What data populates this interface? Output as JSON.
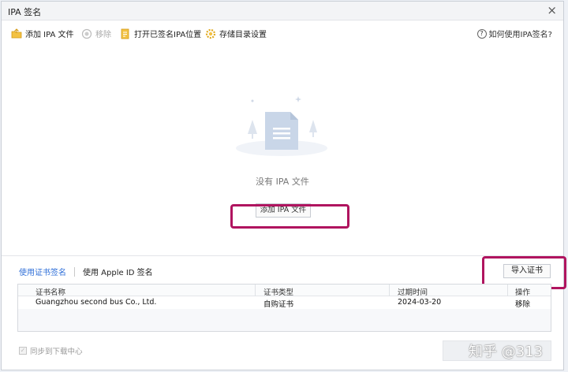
{
  "window": {
    "title": "IPA 签名",
    "close_glyph": "×"
  },
  "toolbar": {
    "add_ipa": "添加 IPA 文件",
    "remove": "移除",
    "open_signed_location": "打开已签名IPA位置",
    "storage_settings": "存储目录设置",
    "help": "如何使用IPA签名?"
  },
  "empty_state": {
    "message": "没有 IPA 文件",
    "add_button": "添加 IPA 文件"
  },
  "cert_tabs": {
    "cert_sign": "使用证书签名",
    "apple_id_sign": "使用 Apple ID 签名"
  },
  "import_button": "导入证书",
  "table": {
    "headers": [
      "证书名称",
      "证书类型",
      "过期时间",
      "操作"
    ],
    "rows": [
      {
        "name": "Guangzhou second bus Co., Ltd.",
        "type": "自购证书",
        "expiry": "2024-03-20",
        "action": "移除"
      }
    ]
  },
  "footer": {
    "sync_label": "同步到下载中心",
    "watermark": "知乎 @313"
  },
  "colors": {
    "accent": "#2f6fd8",
    "highlight": "#b0145f"
  },
  "icons": [
    "add-folder-icon",
    "remove-icon",
    "open-folder-icon",
    "gear-icon",
    "help-icon",
    "document-icon",
    "close-icon"
  ]
}
